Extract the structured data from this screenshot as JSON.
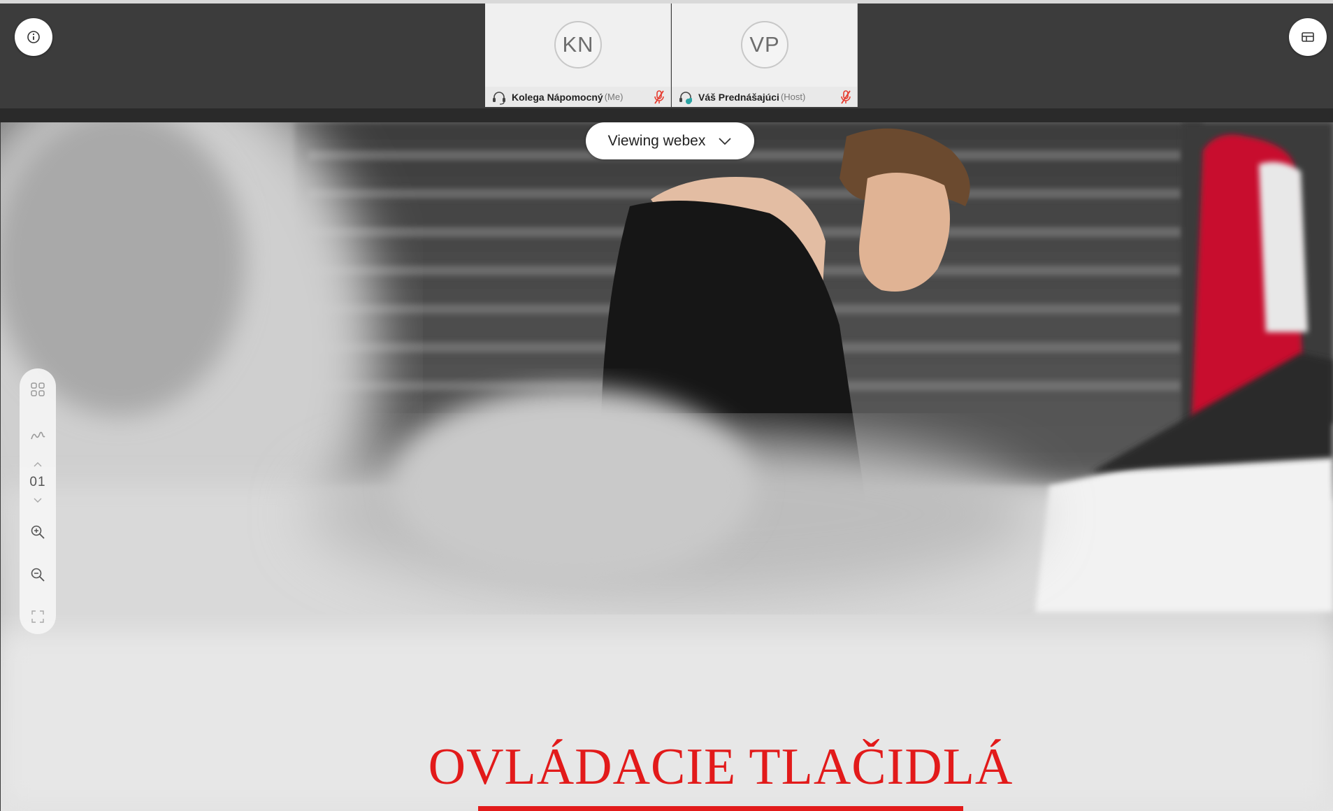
{
  "participants": [
    {
      "initials": "KN",
      "name": "Kolega Nápomocný",
      "tag": "(Me)"
    },
    {
      "initials": "VP",
      "name": "Váš Prednášajúci",
      "tag": "(Host)"
    }
  ],
  "icons": {
    "info": "info-icon",
    "layout": "layout-icon",
    "headset": "headset-icon",
    "mute": "muted-mic-icon",
    "chevron": "chevron-down-icon"
  },
  "viewing": {
    "label": "Viewing webex"
  },
  "toolbar": {
    "page_number": "01",
    "items": [
      "thumbnails-icon",
      "annotate-icon",
      "page-up-icon",
      "page-down-icon",
      "zoom-in-icon",
      "zoom-out-icon",
      "fit-icon"
    ]
  },
  "slide": {
    "title": "OVLÁDACIE TLAČIDLÁ"
  },
  "colors": {
    "accent_red": "#e21a1a",
    "mute_red": "#e63b2e",
    "headset_teal": "#2aa3a3"
  }
}
